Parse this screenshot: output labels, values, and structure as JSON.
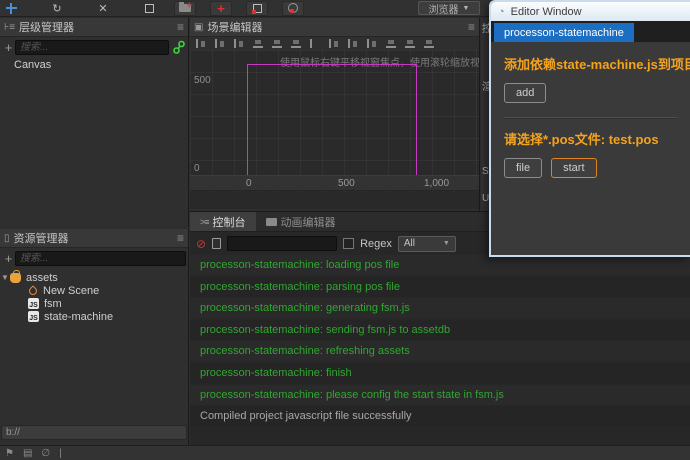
{
  "colors": {
    "accent_orange": "#f5a31d",
    "log_green": "#2fa82f",
    "tab_blue": "#1b6ec2",
    "canvas_magenta": "#c837c8"
  },
  "toolbar": {
    "browser_dropdown": "浏览器",
    "browser_arrow": "▼"
  },
  "hierarchy": {
    "title": "层级管理器",
    "menu_icon": "≡",
    "add_label": "+",
    "search_placeholder": "搜索...",
    "items": [
      {
        "label": "Canvas"
      }
    ]
  },
  "scene": {
    "title": "场景编辑器",
    "menu_icon": "≡",
    "hint": "使用鼠标右键平移视窗焦点，使用滚轮缩放视图",
    "ruler_y": [
      "500",
      "0"
    ],
    "ruler_x": [
      "0",
      "500",
      "1,000"
    ]
  },
  "widget_library": {
    "partial_labels": [
      "控",
      "渲",
      "S",
      "UI"
    ]
  },
  "console": {
    "tabs": [
      {
        "label": "控制台"
      },
      {
        "label": "动画编辑器"
      }
    ],
    "clear_icon": "⊘",
    "search_value": "",
    "regex_label": "Regex",
    "level_selected": "All",
    "level_arrow": "▼",
    "logs": [
      {
        "text": "processon-statemachine: loading pos file",
        "type": "log"
      },
      {
        "text": "processon-statemachine: parsing pos file",
        "type": "log"
      },
      {
        "text": "processon-statemachine: generating fsm.js",
        "type": "log"
      },
      {
        "text": "processon-statemachine: sending fsm.js to assetdb",
        "type": "log"
      },
      {
        "text": "processon-statemachine: refreshing assets",
        "type": "log"
      },
      {
        "text": "processon-statemachine: finish",
        "type": "log"
      },
      {
        "text": "processon-statemachine: please config the start state in fsm.js",
        "type": "log"
      },
      {
        "text": "Compiled project javascript file successfully",
        "type": "info"
      }
    ]
  },
  "assets": {
    "title": "资源管理器",
    "menu_icon": "≡",
    "add_label": "+",
    "search_placeholder": "搜索...",
    "tree": [
      {
        "label": "assets",
        "icon": "folder-bag-icon",
        "caret": "▼"
      },
      {
        "label": "New Scene",
        "icon": "scene-icon"
      },
      {
        "label": "fsm",
        "icon": "js-icon",
        "badge": "JS"
      },
      {
        "label": "state-machine",
        "icon": "js-icon",
        "badge": "JS"
      }
    ],
    "path": "b://"
  },
  "statusbar": {
    "icons": [
      "⚑",
      "▤",
      "∅",
      "|"
    ]
  },
  "editor_window": {
    "title": "Editor Window",
    "tab": "processon-statemachine",
    "section1": {
      "text": "添加依赖state-machine.js到项目",
      "button": "add"
    },
    "section2": {
      "text": "请选择*.pos文件: test.pos",
      "button_file": "file",
      "button_start": "start"
    }
  }
}
